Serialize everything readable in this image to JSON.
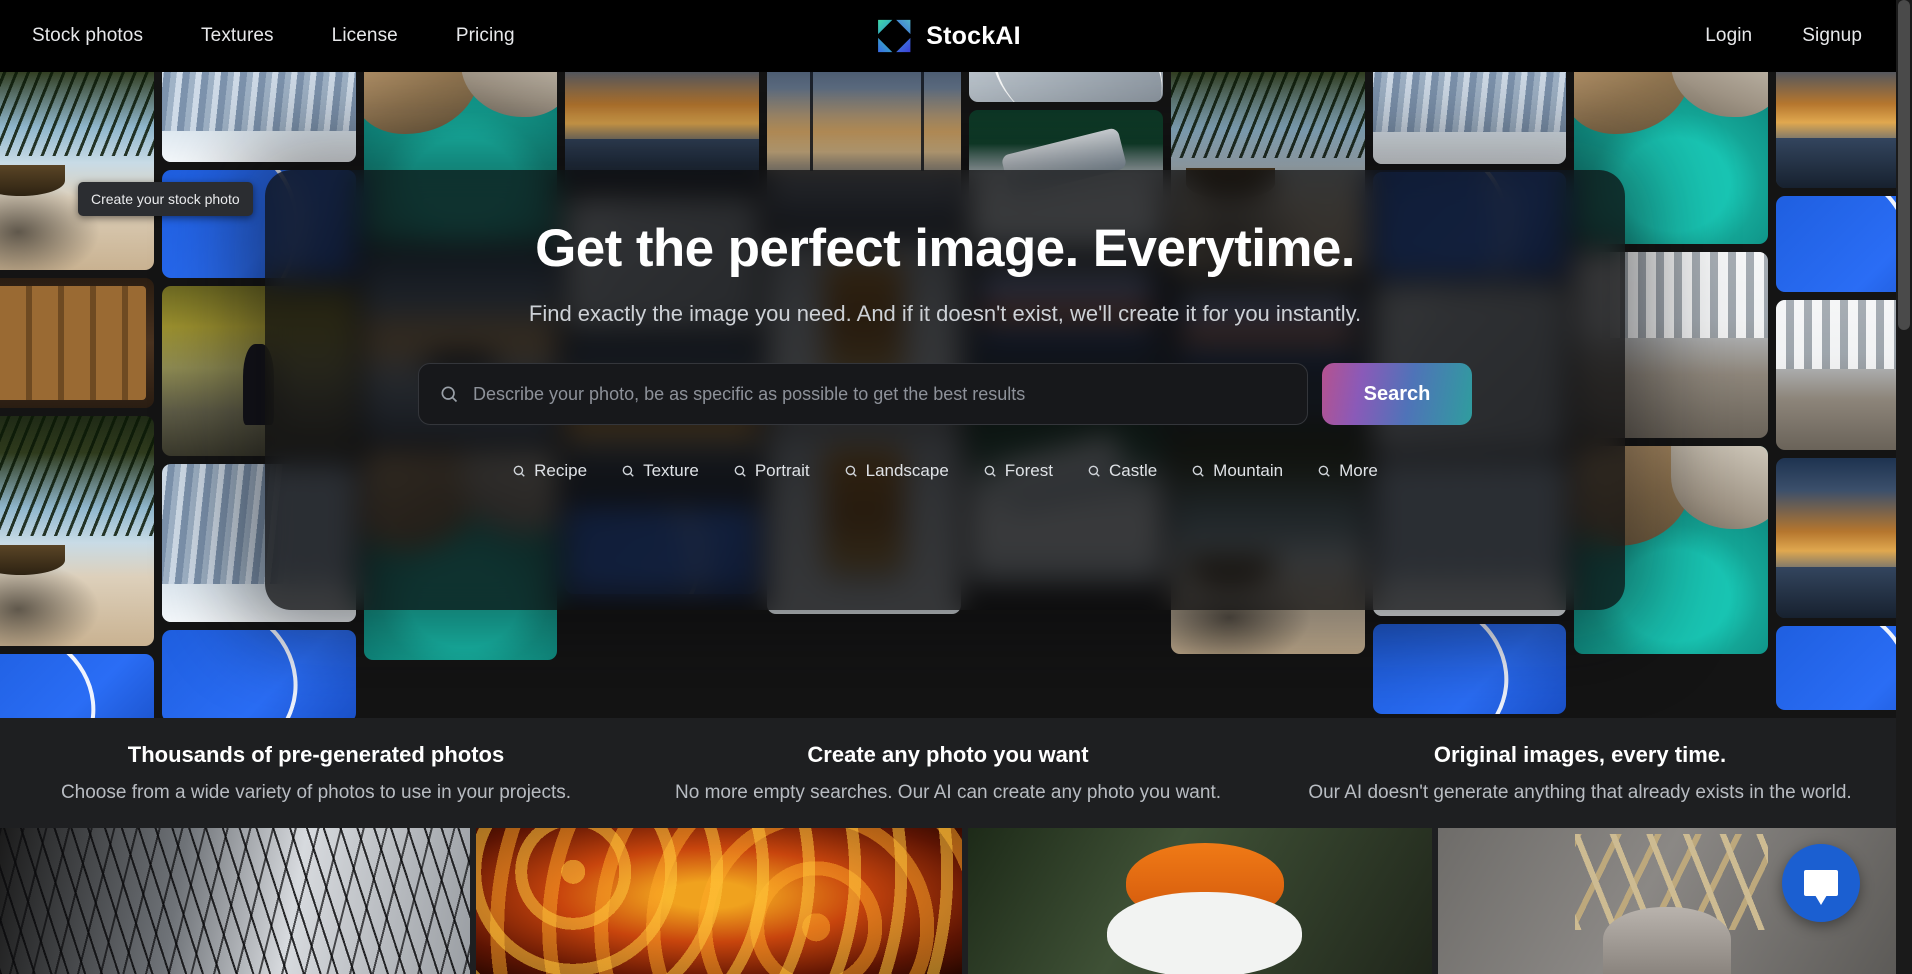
{
  "nav": {
    "links": [
      {
        "label": "Stock photos"
      },
      {
        "label": "Textures"
      },
      {
        "label": "License"
      },
      {
        "label": "Pricing"
      }
    ],
    "brand": "StockAI",
    "login": "Login",
    "signup": "Signup"
  },
  "tooltip": {
    "text": "Create your stock photo"
  },
  "hero": {
    "title": "Get the perfect image. Everytime.",
    "subtitle": "Find exactly the image you need. And if it doesn't exist, we'll create it for you instantly.",
    "search": {
      "placeholder": "Describe your photo, be as specific as possible to get the best results",
      "value": "",
      "button": "Search",
      "icon": "search-icon"
    },
    "categories": [
      {
        "label": "Recipe",
        "icon": "search-icon"
      },
      {
        "label": "Texture",
        "icon": "search-icon"
      },
      {
        "label": "Portrait",
        "icon": "search-icon"
      },
      {
        "label": "Landscape",
        "icon": "search-icon"
      },
      {
        "label": "Forest",
        "icon": "search-icon"
      },
      {
        "label": "Castle",
        "icon": "search-icon"
      },
      {
        "label": "Mountain",
        "icon": "search-icon"
      },
      {
        "label": "More",
        "icon": "search-icon"
      }
    ]
  },
  "features": [
    {
      "title": "Thousands of pre-generated photos",
      "description": "Choose from a wide variety of photos to use in your projects."
    },
    {
      "title": "Create any photo you want",
      "description": "No more empty searches. Our AI can create any photo you want."
    },
    {
      "title": "Original images, every time.",
      "description": "Our AI doesn't generate anything that already exists in the world."
    }
  ],
  "chat": {
    "icon": "chat-bubble-icon"
  },
  "colors": {
    "background": "#0a0a0a",
    "nav_background": "#000000",
    "panel": "rgba(12,12,14,0.80)",
    "accent_gradient_start": "#b5528f",
    "accent_gradient_end": "#2f9d9e",
    "chat_blue": "#1b5fd1",
    "feature_band": "#1e1f21",
    "text_primary": "#ffffff",
    "text_secondary": "#b8bcc2"
  }
}
